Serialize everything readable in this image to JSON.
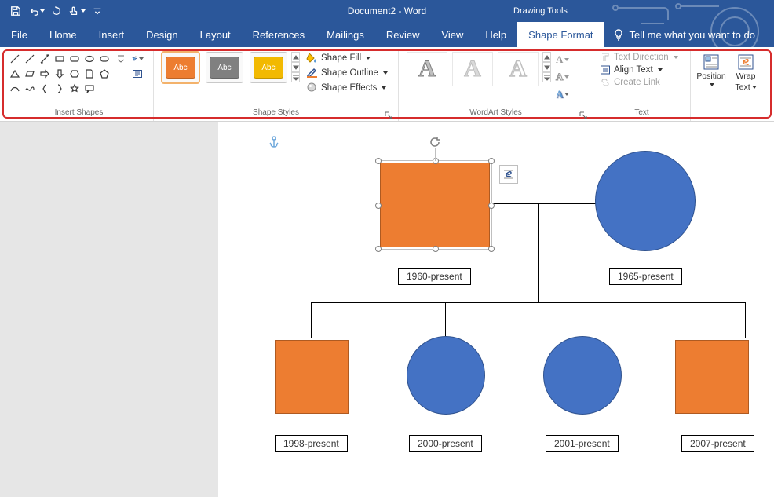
{
  "app": {
    "title": "Document2  -  Word",
    "contextTab": "Drawing Tools"
  },
  "menu": {
    "file": "File",
    "home": "Home",
    "insert": "Insert",
    "design": "Design",
    "layout": "Layout",
    "references": "References",
    "mailings": "Mailings",
    "review": "Review",
    "view": "View",
    "help": "Help",
    "shapeFormat": "Shape Format",
    "tellMe": "Tell me what you want to do"
  },
  "ribbon": {
    "insertShapes": {
      "label": "Insert Shapes"
    },
    "shapeStyles": {
      "label": "Shape Styles",
      "thumbText": "Abc",
      "fill": "Shape Fill",
      "outline": "Shape Outline",
      "effects": "Shape Effects",
      "colors": {
        "t1": "#ed7d31",
        "t2": "#808080",
        "t3": "#f2b900"
      }
    },
    "wordart": {
      "label": "WordArt Styles",
      "sample": "A"
    },
    "text": {
      "label": "Text",
      "direction": "Text Direction",
      "align": "Align Text",
      "link": "Create Link"
    },
    "arrange": {
      "position": "Position",
      "wrap1": "Wrap",
      "wrap2": "Text"
    }
  },
  "doc": {
    "labels": {
      "p1": "1960-present",
      "p2": "1965-present",
      "c1": "1998-present",
      "c2": "2000-present",
      "c3": "2001-present",
      "c4": "2007-present"
    }
  }
}
